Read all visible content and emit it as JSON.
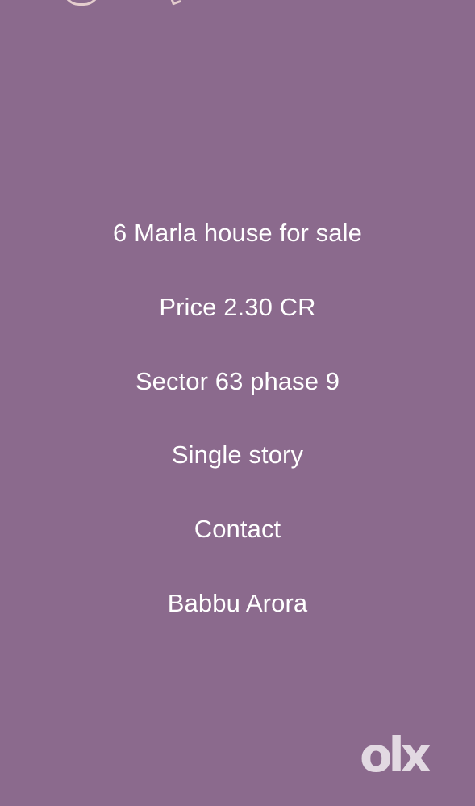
{
  "ad": {
    "lines": [
      "6 Marla house for sale",
      "Price 2.30 CR",
      "Sector 63 phase 9",
      "Single story",
      "Contact",
      "Babbu Arora"
    ]
  },
  "brand": {
    "logo_text": "olx"
  },
  "colors": {
    "background": "#8b6a8d",
    "text": "#ffffff",
    "logo": "rgba(255,255,255,0.75)"
  }
}
